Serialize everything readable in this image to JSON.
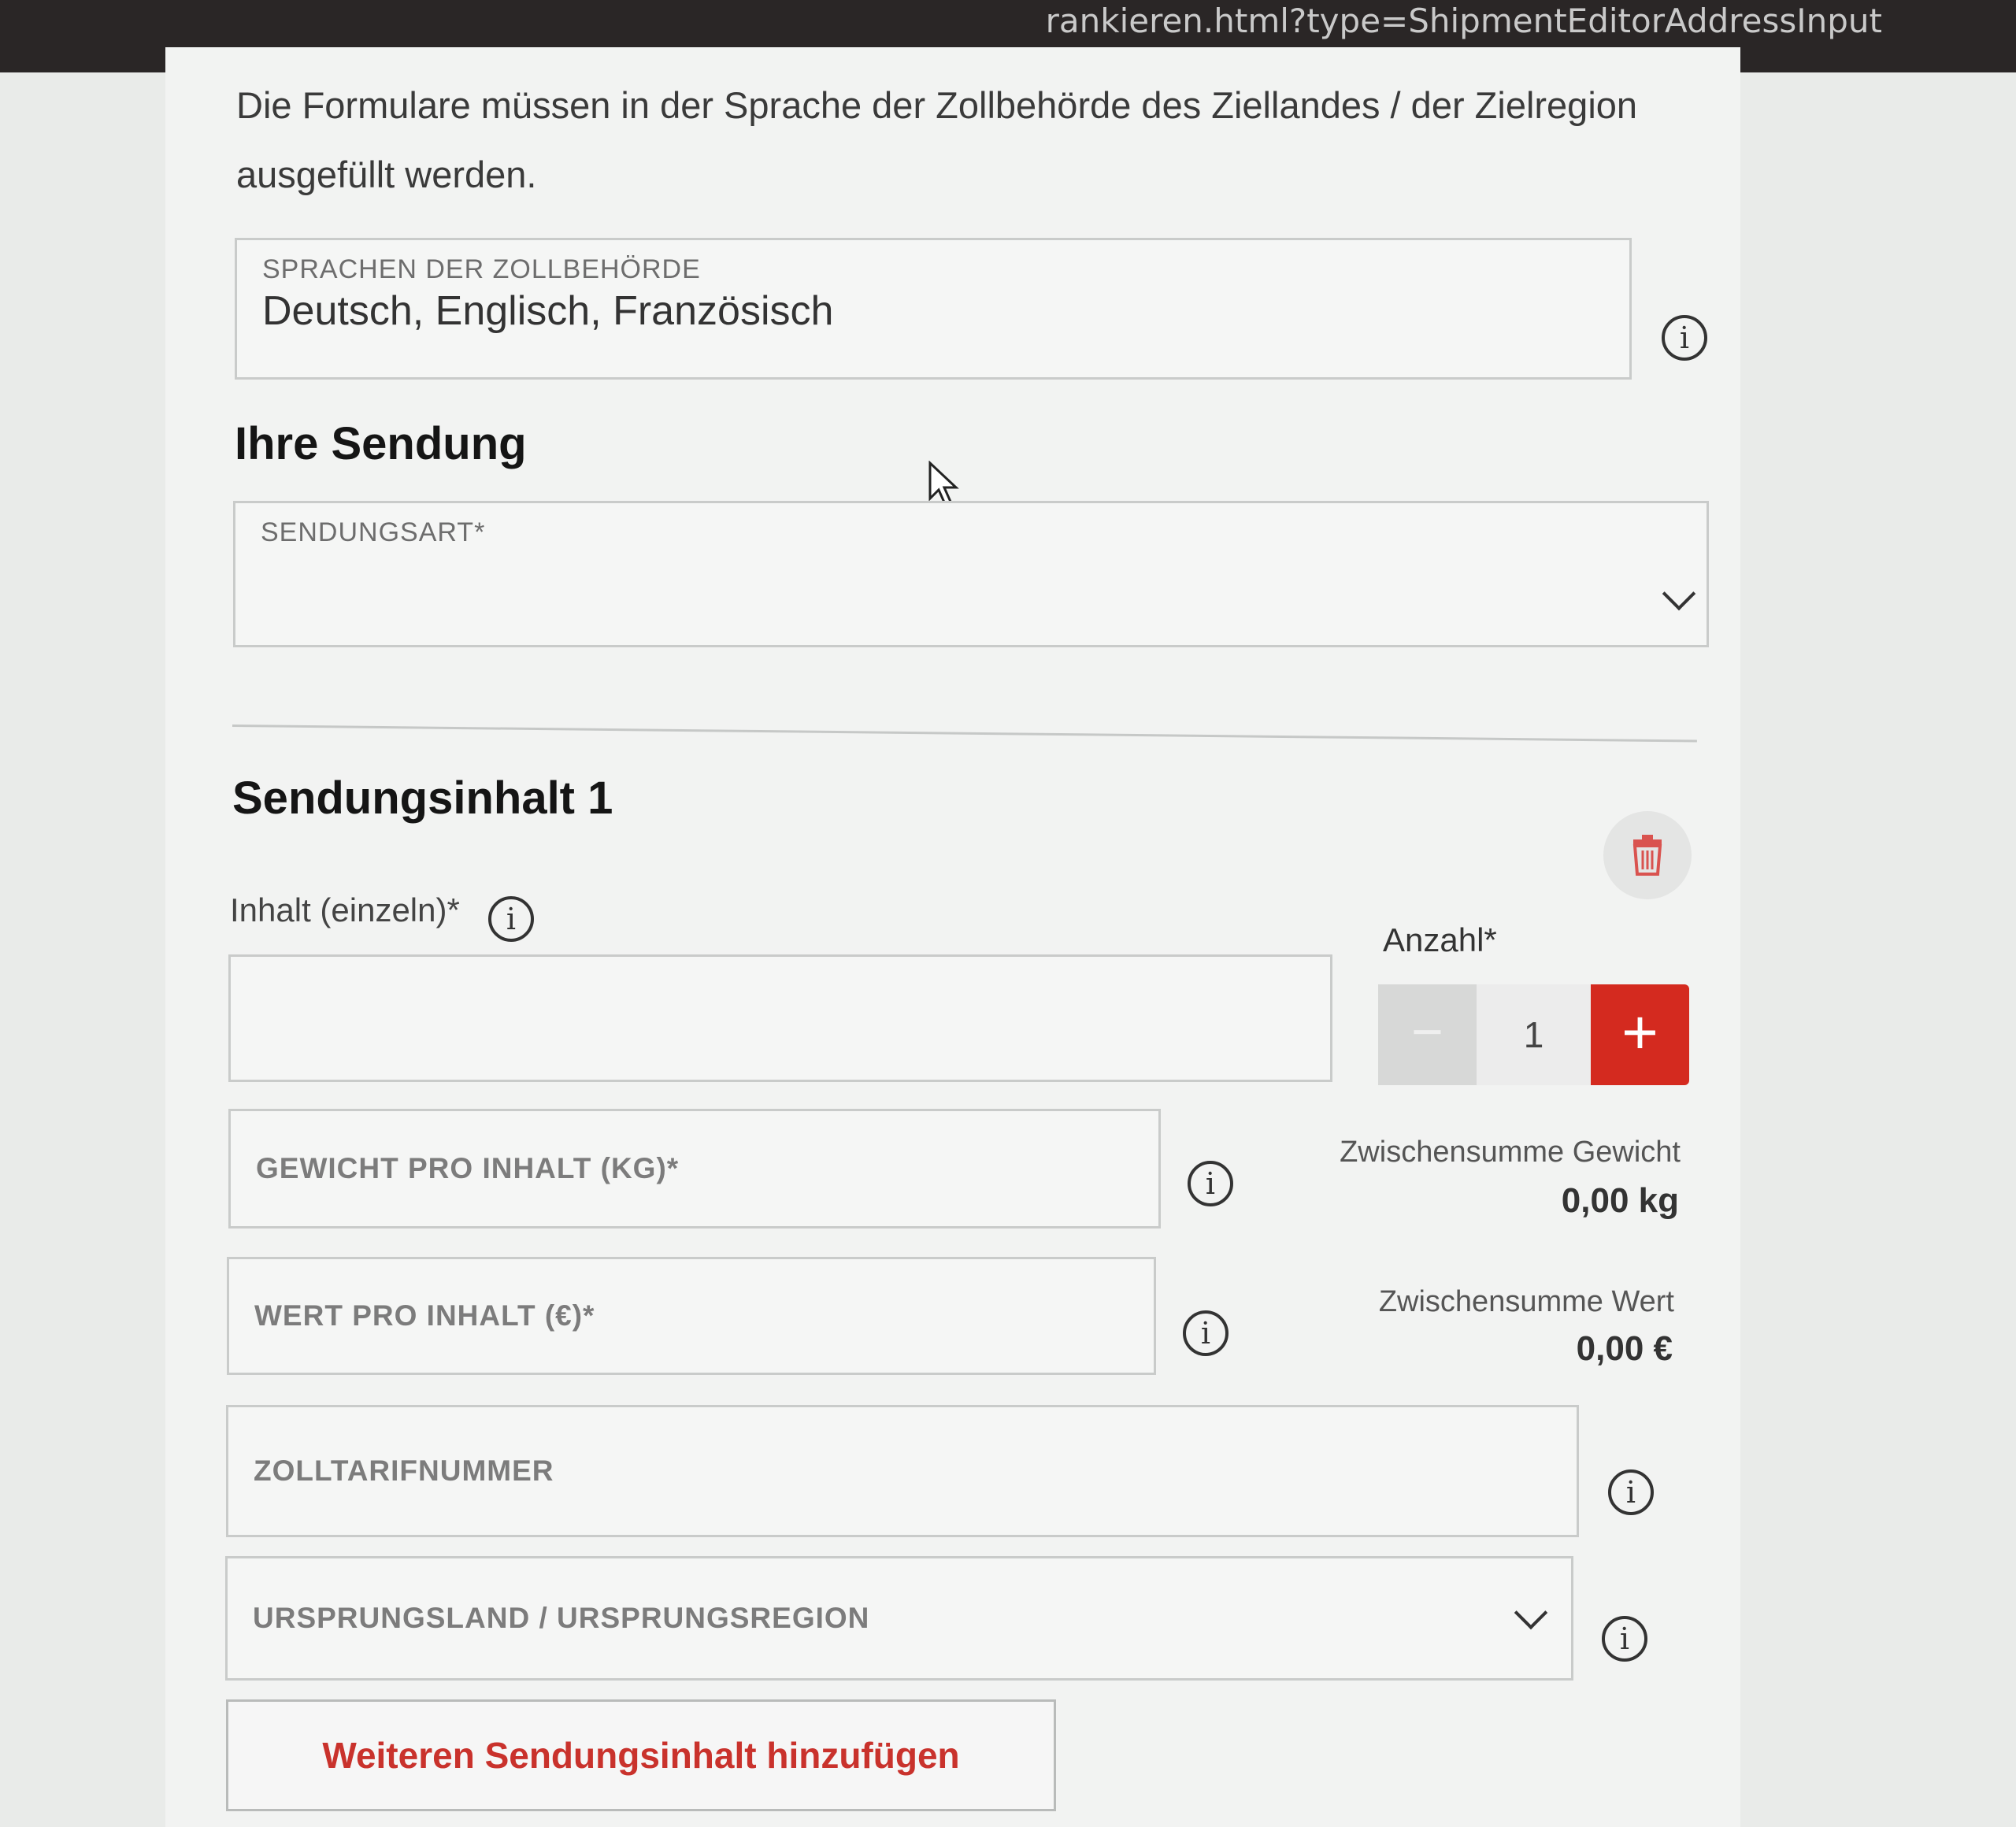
{
  "browser": {
    "url_fragment": "rankieren.html?type=ShipmentEditorAddressInput"
  },
  "intro": {
    "line1": "Die Formulare müssen in der Sprache der Zollbehörde des Ziellandes / der Zielregion",
    "line2": "ausgefüllt werden."
  },
  "customs_language": {
    "label": "SPRACHEN DER ZOLLBEHÖRDE",
    "value": "Deutsch, Englisch, Französisch"
  },
  "shipment": {
    "heading": "Ihre Sendung",
    "type_label": "SENDUNGSART*",
    "type_value": ""
  },
  "content": {
    "heading": "Sendungsinhalt 1",
    "item_label": "Inhalt (einzeln)*",
    "item_value": "",
    "quantity_label": "Anzahl*",
    "quantity_value": "1",
    "minus_symbol": "−",
    "plus_symbol": "+",
    "weight_label": "GEWICHT PRO INHALT (KG)*",
    "value_label": "WERT PRO INHALT (€)*",
    "tariff_label": "ZOLLTARIFNUMMER",
    "origin_label": "URSPRUNGSLAND / URSPRUNGSREGION",
    "subtotal_weight_label": "Zwischensumme Gewicht",
    "subtotal_weight_value": "0,00 kg",
    "subtotal_value_label": "Zwischensumme Wert",
    "subtotal_value_value": "0,00 €"
  },
  "info_glyph": "i",
  "add_button": "Weiteren Sendungsinhalt hinzufügen",
  "colors": {
    "accent_red": "#d42a1f",
    "link_red": "#c9322c"
  },
  "icons": [
    "info-icon",
    "chevron-down-icon",
    "trash-icon",
    "mouse-cursor-icon",
    "minus-icon",
    "plus-icon"
  ]
}
